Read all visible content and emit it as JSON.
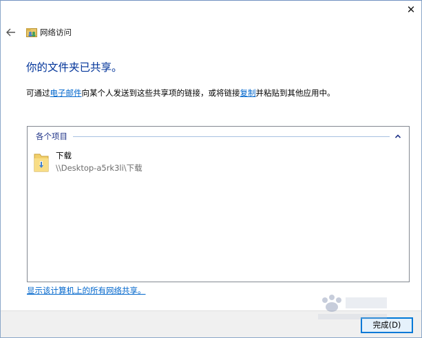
{
  "window": {
    "close_glyph": "✕",
    "title": "网络访问"
  },
  "header": {
    "back_label": "←"
  },
  "main": {
    "heading": "你的文件夹已共享。",
    "desc_part1": "可通过",
    "desc_link_email": "电子邮件",
    "desc_part2": "向某个人发送到这些共享项的链接，或将链接",
    "desc_link_copy": "复制",
    "desc_part3": "并粘贴到其他应用中。"
  },
  "list": {
    "group_label": "各个项目",
    "items": [
      {
        "name": "下载",
        "path": "\\\\Desktop-a5rk3li\\下载",
        "icon": "folder-download-icon"
      }
    ]
  },
  "footer": {
    "show_all_link": "显示该计算机上的所有网络共享。",
    "finish_label": "完成(D)"
  },
  "colors": {
    "heading": "#003399",
    "link": "#0066cc",
    "group_label": "#1e3287",
    "footer_bg": "#f0f0f0",
    "button_border": "#0078d7"
  }
}
